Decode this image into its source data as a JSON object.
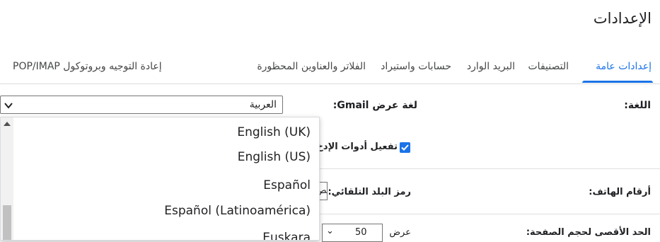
{
  "page": {
    "title": "الإعدادات"
  },
  "tabs": [
    {
      "label": "إعدادات عامة",
      "active": true
    },
    {
      "label": "التصنيفات"
    },
    {
      "label": "البريد الوارد"
    },
    {
      "label": "حسابات واستيراد"
    },
    {
      "label": "الفلاتر والعناوين المحظورة"
    },
    {
      "label": "إعادة التوجيه وبروتوكول POP/IMAP"
    }
  ],
  "settings": {
    "language": {
      "label": "اللغة:",
      "display_language_label": "لغة عرض Gmail:",
      "selected": "العربية",
      "input_tools_label": "تفعيل أدوات الإدخ"
    },
    "phone": {
      "label": "أرقام الهاتف:",
      "country_code_label": "رمز البلد التلقائي:",
      "country_code_value": "مص"
    },
    "page_size": {
      "label": "الحد الأقصى لحجم الصفحة:",
      "show_label": "عرض",
      "value": "50"
    }
  },
  "dropdown": {
    "options": [
      "English (UK)",
      "English (US)",
      "Español",
      "Español (Latinoamérica)",
      "Euskara"
    ]
  },
  "colors": {
    "accent": "#1a73e8"
  }
}
